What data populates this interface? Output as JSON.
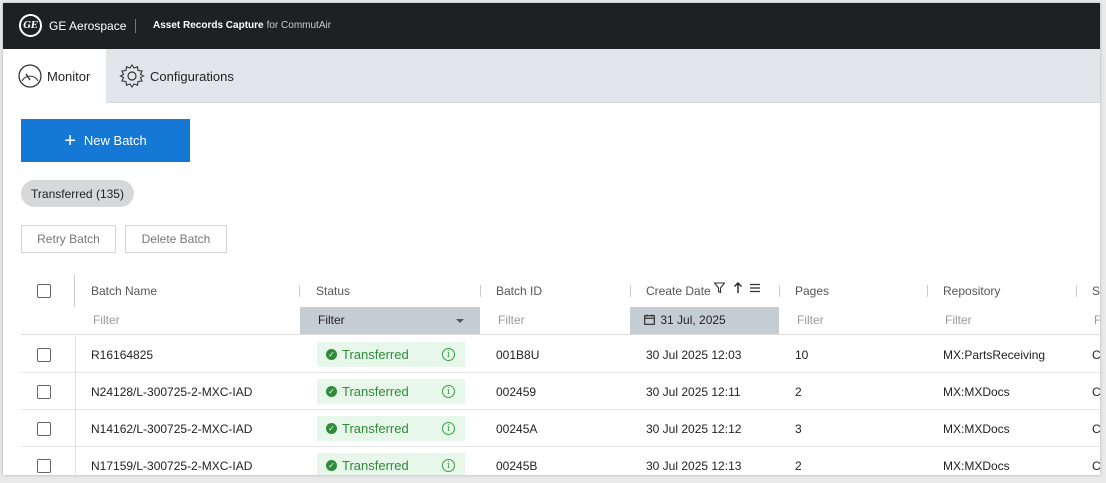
{
  "header": {
    "logo_text": "GE",
    "brand": "GE Aerospace",
    "app_title": "Asset Records Capture",
    "app_subtitle": "for CommutAir"
  },
  "nav": {
    "tabs": [
      {
        "label": "Monitor",
        "icon": "gauge-icon",
        "active": true
      },
      {
        "label": "Configurations",
        "icon": "gear-icon",
        "active": false
      }
    ]
  },
  "actions": {
    "new_batch_label": "New Batch",
    "retry_label": "Retry Batch",
    "delete_label": "Delete Batch"
  },
  "status_chip": "Transferred (135)",
  "table": {
    "columns": [
      "Batch Name",
      "Status",
      "Batch ID",
      "Create Date",
      "Pages",
      "Repository",
      "Sc"
    ],
    "filters": {
      "batch_name": "Filter",
      "status": "Filter",
      "batch_id": "Filter",
      "create_date": "31 Jul, 2025",
      "pages": "Filter",
      "repository": "Filter",
      "extra": "F"
    },
    "rows": [
      {
        "name": "R16164825",
        "status": "Transferred",
        "batch_id": "001B8U",
        "date": "30 Jul 2025 12:03",
        "pages": "10",
        "repository": "MX:PartsReceiving",
        "extra": "C"
      },
      {
        "name": "N24128/L-300725-2-MXC-IAD",
        "status": "Transferred",
        "batch_id": "002459",
        "date": "30 Jul 2025 12:11",
        "pages": "2",
        "repository": "MX:MXDocs",
        "extra": "C"
      },
      {
        "name": "N14162/L-300725-2-MXC-IAD",
        "status": "Transferred",
        "batch_id": "00245A",
        "date": "30 Jul 2025 12:12",
        "pages": "3",
        "repository": "MX:MXDocs",
        "extra": "C"
      },
      {
        "name": "N17159/L-300725-2-MXC-IAD",
        "status": "Transferred",
        "batch_id": "00245B",
        "date": "30 Jul 2025 12:13",
        "pages": "2",
        "repository": "MX:MXDocs",
        "extra": "C"
      }
    ]
  },
  "colors": {
    "topbar": "#1f2022",
    "primary": "#1478d4",
    "success": "#2f8a3a",
    "success_bg": "#e7f7e9",
    "filter_active_bg": "#c5cdd4"
  }
}
